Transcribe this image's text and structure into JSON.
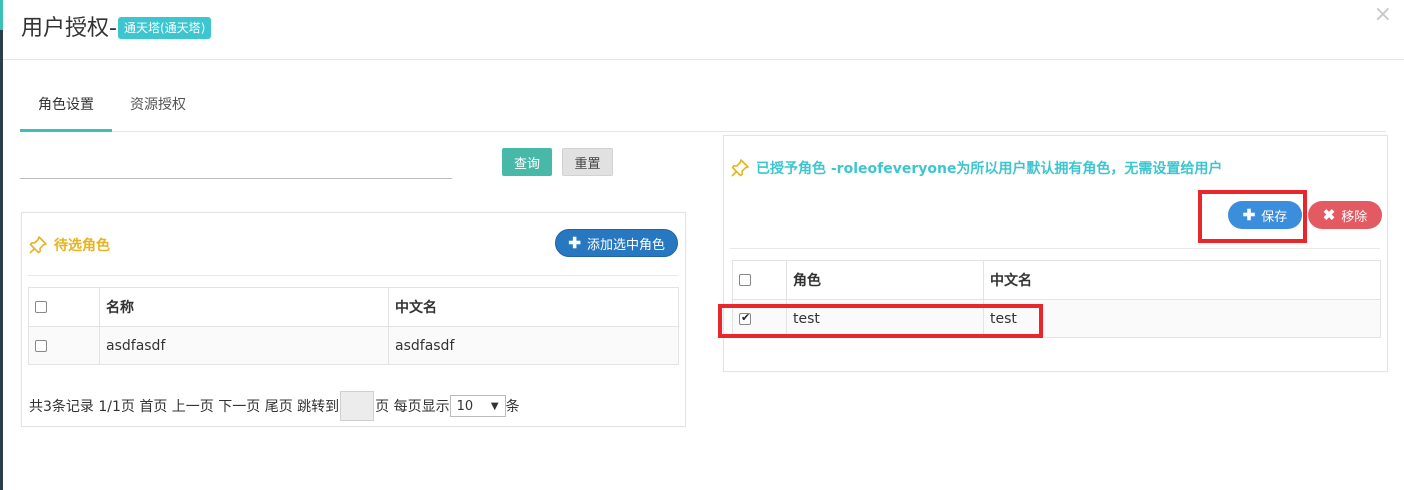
{
  "header": {
    "title": "用户授权-",
    "badge": "通天塔(通天塔)",
    "close": "×"
  },
  "tabs": [
    {
      "label": "角色设置",
      "active": true
    },
    {
      "label": "资源授权",
      "active": false
    }
  ],
  "search": {
    "query_label": "查询",
    "reset_label": "重置"
  },
  "left_panel": {
    "title": "待选角色",
    "add_label": "添加选中角色",
    "columns": [
      "名称",
      "中文名"
    ],
    "rows": [
      {
        "name": "asdfasdf",
        "cn_name": "asdfasdf",
        "checked": false
      }
    ],
    "pager": {
      "summary": "共3条记录 1/1页 首页 上一页 下一页 尾页 跳转到",
      "page_suffix": "页 每页显示",
      "page_size": "10",
      "unit": "条"
    }
  },
  "right_panel": {
    "title": "已授予角色 -roleofeveryone为所以用户默认拥有角色，无需设置给用户",
    "save_label": "保存",
    "remove_label": "移除",
    "columns": [
      "角色",
      "中文名"
    ],
    "rows": [
      {
        "role": "test",
        "cn_name": "test",
        "checked": true
      }
    ]
  },
  "colors": {
    "accent_teal": "#3cbfb5",
    "badge": "#3ec6d0",
    "left_title": "#e6b422",
    "right_title": "#3ec6d0",
    "add_button": "#2778c0",
    "save_button": "#3a8edc",
    "remove_button": "#e35a63",
    "highlight_box": "#e8262c"
  }
}
